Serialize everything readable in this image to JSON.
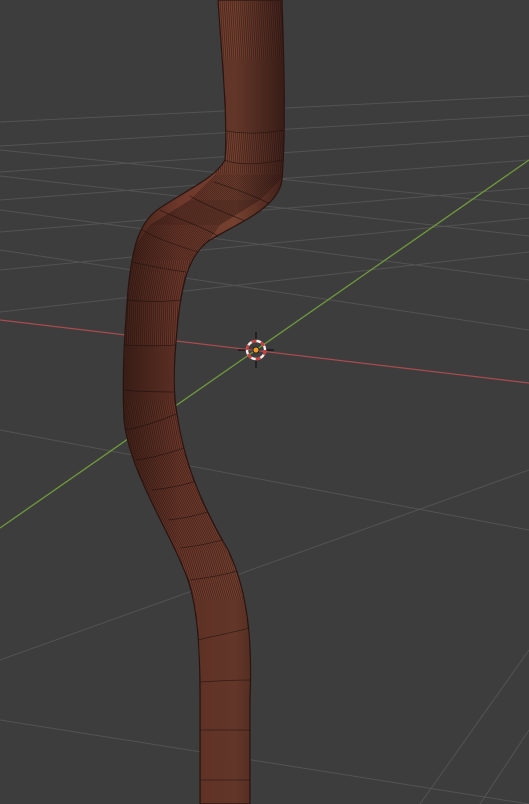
{
  "viewport": {
    "background_color": "#3d3d3d",
    "grid_color": "#535353",
    "x_axis_color": "#a94b4f",
    "y_axis_color": "#6f9a3c",
    "object_color": "#6e382b",
    "object_dark_color": "#45231b",
    "wire_color": "#1a0f0c",
    "cursor_ring_color": "#cf3b3b",
    "cursor_ring_alt_color": "#f0f0f0",
    "origin_color": "#f29a26"
  }
}
